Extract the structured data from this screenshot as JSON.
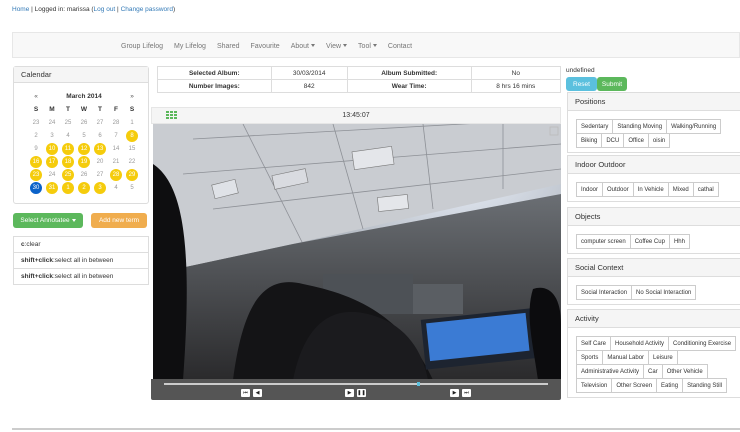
{
  "header": {
    "home": "Home",
    "logged_in": "| Logged in: marissa (",
    "logout": "Log out",
    "sep": "|",
    "change_password": "Change password",
    "close": ")"
  },
  "nav": {
    "items": [
      "Group Lifelog",
      "My Lifelog",
      "Shared",
      "Favourite",
      "About",
      "View",
      "Tool",
      "Contact"
    ]
  },
  "calendar": {
    "title": "Calendar",
    "month": "March 2014",
    "prev": "«",
    "next": "»",
    "weekdays": [
      "S",
      "M",
      "T",
      "W",
      "T",
      "F",
      "S"
    ],
    "weeks": [
      [
        "23",
        "24",
        "25",
        "26",
        "27",
        "28",
        "1"
      ],
      [
        "2",
        "3",
        "4",
        "5",
        "6",
        "7",
        "8"
      ],
      [
        "9",
        "10",
        "11",
        "12",
        "13",
        "14",
        "15"
      ],
      [
        "16",
        "17",
        "18",
        "19",
        "20",
        "21",
        "22"
      ],
      [
        "23",
        "24",
        "25",
        "26",
        "27",
        "28",
        "29"
      ],
      [
        "30",
        "31",
        "1",
        "2",
        "3",
        "4",
        "5"
      ]
    ],
    "highlighted": [
      "8",
      "10",
      "11",
      "12",
      "13",
      "16",
      "17",
      "18",
      "19",
      "23",
      "25",
      "28",
      "29",
      "31",
      "1b",
      "2b",
      "3b"
    ],
    "selected": "30"
  },
  "buttons": {
    "select_annotatee": "Select Annotatee",
    "add_new_term": "Add new term",
    "reset": "Reset",
    "submit": "Submit"
  },
  "shortcuts": [
    {
      "key": "c",
      "text": ":clear"
    },
    {
      "key": "shift+click",
      "text": ":select all in between"
    },
    {
      "key": "shift+click",
      "text": ":select all in between"
    }
  ],
  "info": {
    "selected_album_label": "Selected Album:",
    "selected_album": "30/03/2014",
    "album_submitted_label": "Album Submitted:",
    "album_submitted": "No",
    "number_images_label": "Number Images:",
    "number_images": "842",
    "wear_time_label": "Wear Time:",
    "wear_time": "8 hrs 16 mins"
  },
  "viewer": {
    "time": "13:45:07",
    "progress": 0.66
  },
  "right": {
    "status": "undefined"
  },
  "categories": [
    {
      "title": "Positions",
      "tags": [
        "Sedentary",
        "Standing Moving",
        "Walking/Running",
        "Biking",
        "DCU",
        "Office",
        "oisin"
      ]
    },
    {
      "title": "Indoor Outdoor",
      "tags": [
        "Indoor",
        "Outdoor",
        "In Vehicle",
        "Mixed",
        "cathal"
      ]
    },
    {
      "title": "Objects",
      "tags": [
        "computer screen",
        "Coffee Cup",
        "Hhh"
      ]
    },
    {
      "title": "Social Context",
      "tags": [
        "Social Interaction",
        "No Social Interaction"
      ]
    },
    {
      "title": "Activity",
      "tags": [
        "Self Care",
        "Household Activity",
        "Conditioning Exercise",
        "Sports",
        "Manual Labor",
        "Leisure",
        "Administrative Activity",
        "Car",
        "Other Vehicle",
        "Television",
        "Other Screen",
        "Eating",
        "Standing Still"
      ]
    }
  ],
  "colors": {
    "green": "#5cb85c",
    "orange": "#f0ad4e",
    "info": "#5bc0de",
    "highlight": "#f5cc0c",
    "selected": "#0b62c9"
  }
}
